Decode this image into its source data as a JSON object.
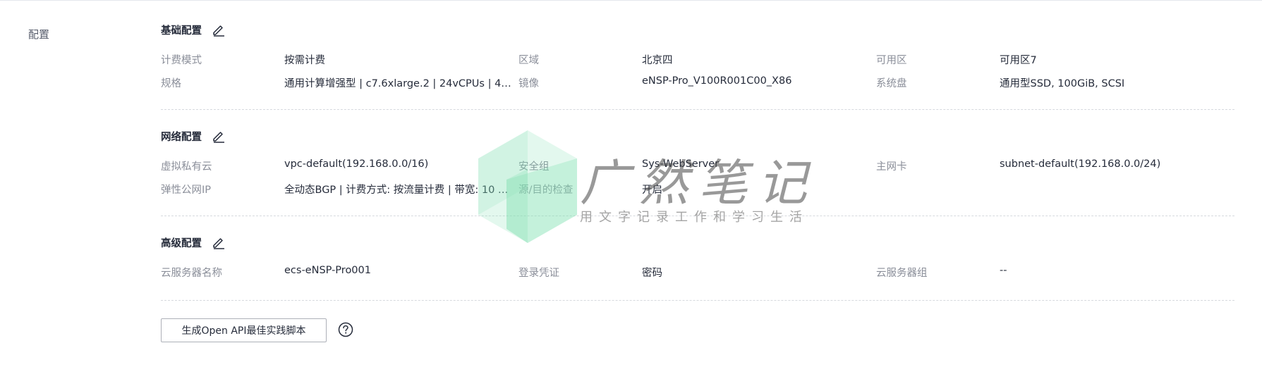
{
  "side": {
    "label": "配置"
  },
  "basic": {
    "title": "基础配置",
    "billing_mode_key": "计费模式",
    "billing_mode_val": "按需计费",
    "region_key": "区域",
    "region_val": "北京四",
    "az_key": "可用区",
    "az_val": "可用区7",
    "flavor_key": "规格",
    "flavor_val": "通用计算增强型 | c7.6xlarge.2 | 24vCPUs | 48…",
    "image_key": "镜像",
    "image_val": "eNSP-Pro_V100R001C00_X86",
    "disk_key": "系统盘",
    "disk_val": "通用型SSD, 100GiB, SCSI"
  },
  "network": {
    "title": "网络配置",
    "vpc_key": "虚拟私有云",
    "vpc_val": "vpc-default(192.168.0.0/16)",
    "sg_key": "安全组",
    "sg_val": "Sys-WebServer",
    "nic_key": "主网卡",
    "nic_val": "subnet-default(192.168.0.0/24)",
    "eip_key": "弹性公网IP",
    "eip_val": "全动态BGP | 计费方式: 按流量计费 | 带宽: 10 …",
    "srcdst_key": "源/目的检查",
    "srcdst_val": "开启"
  },
  "advanced": {
    "title": "高级配置",
    "name_key": "云服务器名称",
    "name_val": "ecs-eNSP-Pro001",
    "cred_key": "登录凭证",
    "cred_val": "密码",
    "group_key": "云服务器组",
    "group_val": "--"
  },
  "actions": {
    "api_button": "生成Open API最佳实践脚本"
  },
  "watermark": {
    "title": "广然笔记",
    "subtitle": "用文字记录工作和学习生活"
  },
  "icons": {
    "edit": "edit-pencil-icon",
    "help": "help-circle-icon"
  },
  "colors": {
    "text": "#252b3a",
    "muted": "#8a8e99",
    "border": "#adb0b8",
    "watermark": "#7ee0b0"
  }
}
